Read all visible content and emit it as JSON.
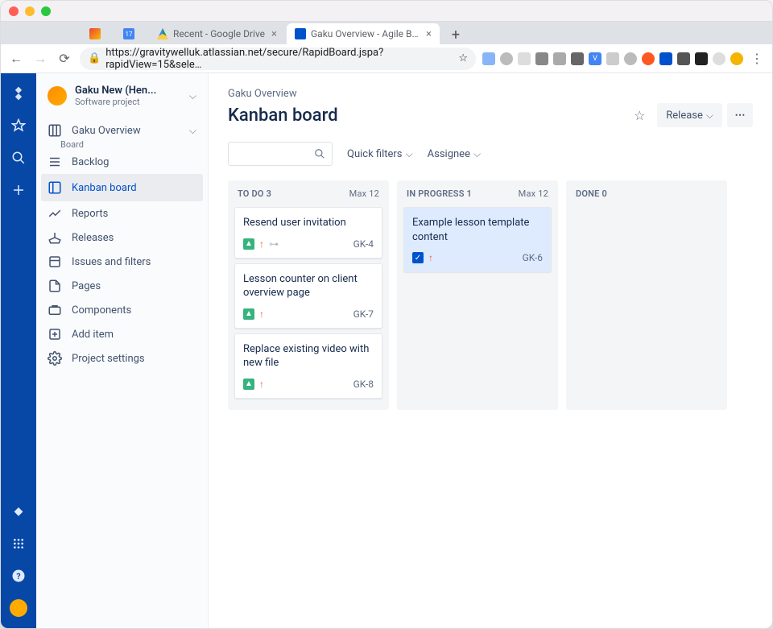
{
  "tabs": [
    {
      "label": "",
      "fav": "gmail"
    },
    {
      "label": "",
      "fav": "cal"
    },
    {
      "label": "Recent - Google Drive",
      "fav": "drive"
    },
    {
      "label": "Gaku Overview - Agile Board - ",
      "fav": "jira",
      "active": true
    }
  ],
  "url": "https://gravitywelluk.atlassian.net/secure/RapidBoard.jspa?rapidView=15&sele…",
  "rail": [
    "jira",
    "star",
    "search",
    "plus"
  ],
  "rail_bottom": [
    "rocket",
    "apps",
    "help",
    "avatar"
  ],
  "project": {
    "name": "Gaku New (Hen...",
    "subtitle": "Software project"
  },
  "sidebar": [
    {
      "icon": "board",
      "label": "Gaku Overview",
      "sub": "Board",
      "chev": true
    },
    {
      "icon": "backlog",
      "label": "Backlog"
    },
    {
      "icon": "kanban",
      "label": "Kanban board",
      "selected": true
    },
    {
      "icon": "reports",
      "label": "Reports"
    },
    {
      "icon": "ship",
      "label": "Releases"
    },
    {
      "icon": "issues",
      "label": "Issues and filters"
    },
    {
      "icon": "pages",
      "label": "Pages"
    },
    {
      "icon": "components",
      "label": "Components"
    },
    {
      "icon": "add",
      "label": "Add item"
    },
    {
      "icon": "settings",
      "label": "Project settings"
    }
  ],
  "breadcrumb": "Gaku Overview",
  "title": "Kanban board",
  "actions": {
    "star": "☆",
    "release": "Release",
    "more": "⋯"
  },
  "filters": {
    "quick": "Quick filters",
    "assignee": "Assignee"
  },
  "columns": [
    {
      "name": "TO DO",
      "count": 3,
      "max": "Max 12",
      "cards": [
        {
          "title": "Resend user invitation",
          "type": "story",
          "prio": true,
          "link": true,
          "key": "GK-4"
        },
        {
          "title": "Lesson counter on client overview page",
          "type": "story",
          "prio": true,
          "key": "GK-7"
        },
        {
          "title": "Replace existing video with new file",
          "type": "story",
          "prio": true,
          "key": "GK-8"
        }
      ]
    },
    {
      "name": "IN PROGRESS",
      "count": 1,
      "max": "Max 12",
      "cards": [
        {
          "title": "Example lesson template content",
          "type": "task",
          "prio": true,
          "key": "GK-6",
          "selected": true
        }
      ]
    },
    {
      "name": "DONE",
      "count": 0,
      "cards": []
    }
  ]
}
